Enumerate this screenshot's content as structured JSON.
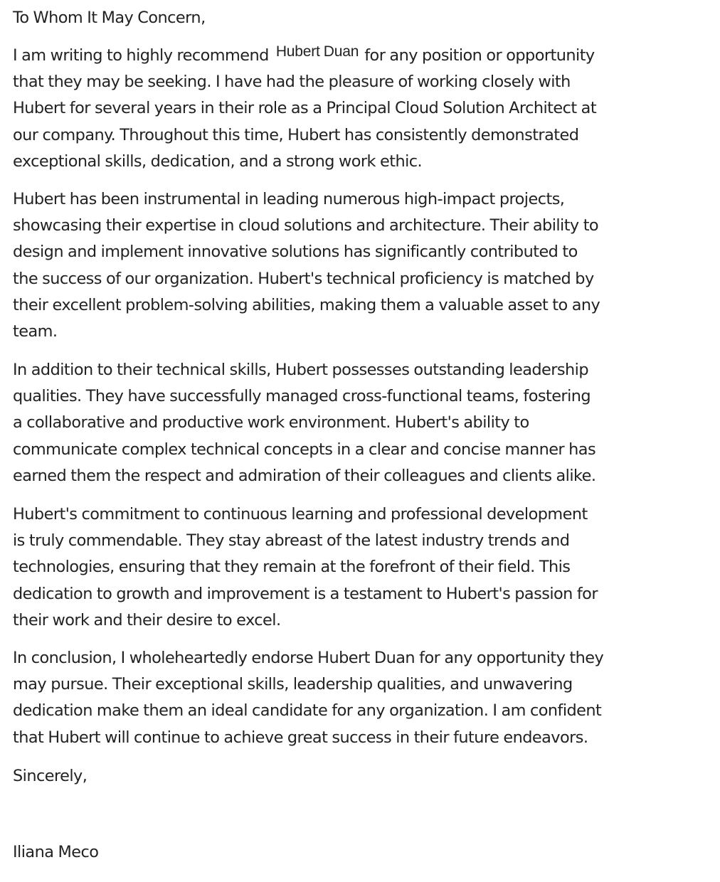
{
  "letter": {
    "greeting": "To Whom It May Concern,",
    "paragraph_1": {
      "line_1_before": "I am writing to highly recommend",
      "inserted_name": "Hubert Duan",
      "line_1_after": "for any position or opportunity",
      "lines": [
        "that they may be seeking. I have had the pleasure of working closely with",
        "Hubert for several years in their role as a Principal Cloud Solution Architect at",
        "our company. Throughout this time, Hubert has consistently demonstrated",
        "exceptional skills, dedication, and a strong work ethic."
      ]
    },
    "paragraph_2": {
      "lines": [
        "Hubert has been instrumental in leading numerous high-impact projects,",
        "showcasing their expertise in cloud solutions and architecture. Their ability to",
        "design and implement innovative solutions has significantly contributed to",
        "the success of our organization. Hubert's technical proficiency is matched by",
        "their excellent problem-solving abilities, making them a valuable asset to any",
        "team."
      ]
    },
    "paragraph_3": {
      "lines": [
        "In addition to their technical skills, Hubert possesses outstanding leadership",
        "qualities. They have successfully managed cross-functional teams, fostering",
        "a collaborative and productive work environment. Hubert's ability to",
        "communicate complex technical concepts in a clear and concise manner has",
        "earned them the respect and admiration of their colleagues and clients alike."
      ]
    },
    "paragraph_4": {
      "lines": [
        "Hubert's commitment to continuous learning and professional development",
        "is truly commendable. They stay abreast of the latest industry trends and",
        "technologies, ensuring that they remain at the forefront of their field. This",
        "dedication to growth and improvement is a testament to Hubert's passion for",
        "their work and their desire to excel."
      ]
    },
    "paragraph_5": {
      "lines": [
        "In conclusion, I wholeheartedly endorse Hubert Duan for any opportunity they",
        "may pursue. Their exceptional skills, leadership qualities, and unwavering",
        "dedication make them an ideal candidate for any organization. I am confident",
        "that Hubert will continue to achieve great success in their future endeavors."
      ]
    },
    "closing": "Sincerely,",
    "signature": "Iliana Meco"
  }
}
